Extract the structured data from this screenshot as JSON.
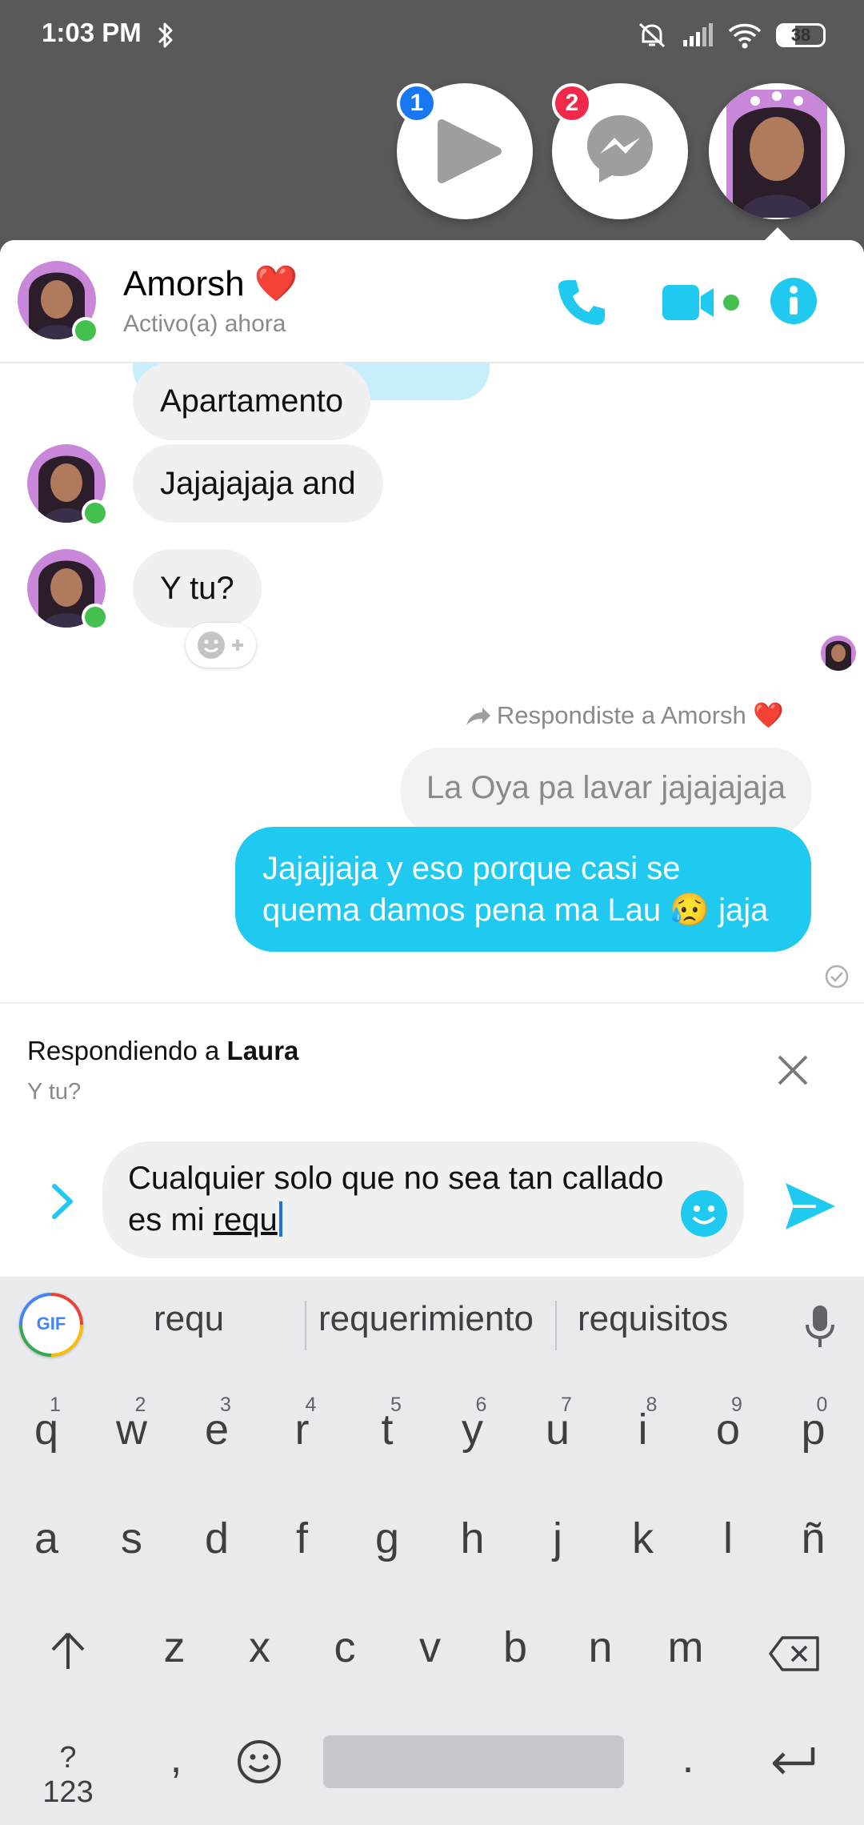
{
  "status_bar": {
    "time": "1:03 PM",
    "battery": "38",
    "battery_level": 0.38
  },
  "chat_heads": [
    {
      "badge": "1",
      "badge_color": "#1877f2",
      "icon": "play-icon"
    },
    {
      "badge": "2",
      "badge_color": "#f02849",
      "icon": "messenger-icon"
    },
    {
      "icon": "avatar"
    }
  ],
  "header": {
    "contact_name": "Amorsh",
    "contact_emoji": "❤️",
    "status": "Activo(a) ahora"
  },
  "messages": {
    "m1": "Apartamento",
    "m2": "Jajajajaja and",
    "m3": "Y tu?",
    "reply_label": "Respondiste a Amorsh ❤️",
    "quoted": "La Oya pa lavar jajajajaja",
    "outgoing": "Jajajjaja y eso porque casi se quema damos pena ma Lau 😥 jaja"
  },
  "reply_bar": {
    "prefix": "Respondiendo a ",
    "name": "Laura",
    "quote": "Y tu?"
  },
  "composer": {
    "text_before": "Cualquier solo que no sea tan callado es mi ",
    "text_underlined": "requ"
  },
  "keyboard": {
    "gif_label": "GIF",
    "suggestions": [
      "requ",
      "requerimiento",
      "requisitos"
    ],
    "row1": [
      "q",
      "w",
      "e",
      "r",
      "t",
      "y",
      "u",
      "i",
      "o",
      "p"
    ],
    "row1_hints": [
      "1",
      "2",
      "3",
      "4",
      "5",
      "6",
      "7",
      "8",
      "9",
      "0"
    ],
    "row2": [
      "a",
      "s",
      "d",
      "f",
      "g",
      "h",
      "j",
      "k",
      "l",
      "ñ"
    ],
    "row3": [
      "z",
      "x",
      "c",
      "v",
      "b",
      "n",
      "m"
    ],
    "symbols_key": "?123",
    "comma": ",",
    "period": "."
  },
  "colors": {
    "accent": "#20c9f0",
    "online": "#44c04f"
  }
}
